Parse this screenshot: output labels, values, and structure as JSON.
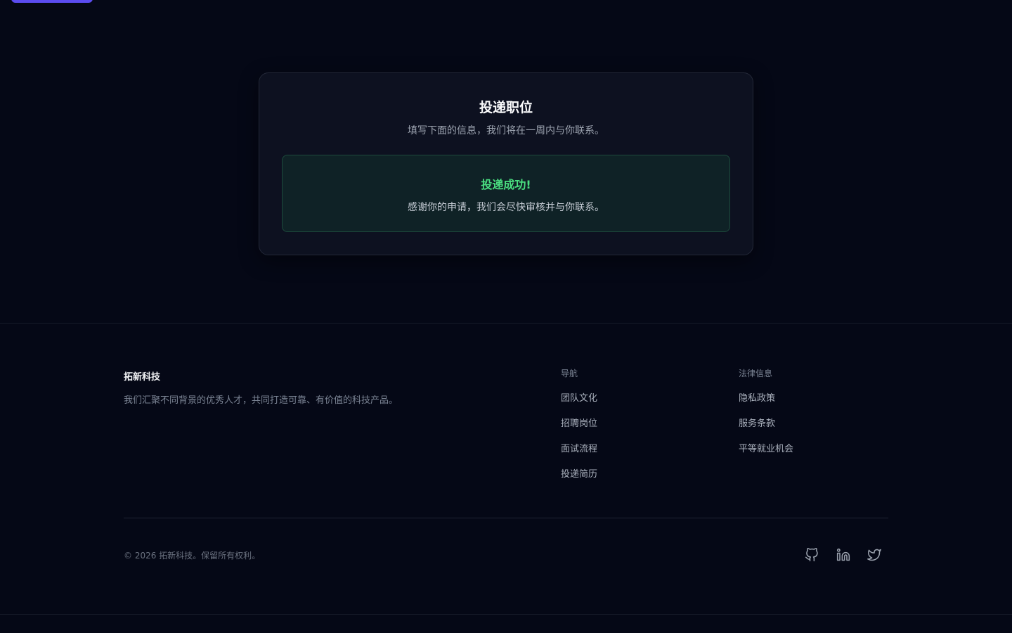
{
  "application": {
    "title": "投递职位",
    "subtitle": "填写下面的信息，我们将在一周内与你联系。",
    "success": {
      "title": "投递成功!",
      "message": "感谢你的申请，我们会尽快审核并与你联系。"
    }
  },
  "footer": {
    "brand": {
      "name": "拓新科技",
      "description": "我们汇聚不同背景的优秀人才，共同打造可靠、有价值的科技产品。"
    },
    "nav": {
      "heading": "导航",
      "links": [
        "团队文化",
        "招聘岗位",
        "面试流程",
        "投递简历"
      ]
    },
    "legal": {
      "heading": "法律信息",
      "links": [
        "隐私政策",
        "服务条款",
        "平等就业机会"
      ]
    },
    "copyright": "© 2026 拓新科技。保留所有权利。",
    "social": [
      "github-icon",
      "linkedin-icon",
      "twitter-icon"
    ]
  },
  "colors": {
    "background": "#050816",
    "card": "#0d1120",
    "accent": "#5b4cf0",
    "success": "#4ade80"
  }
}
